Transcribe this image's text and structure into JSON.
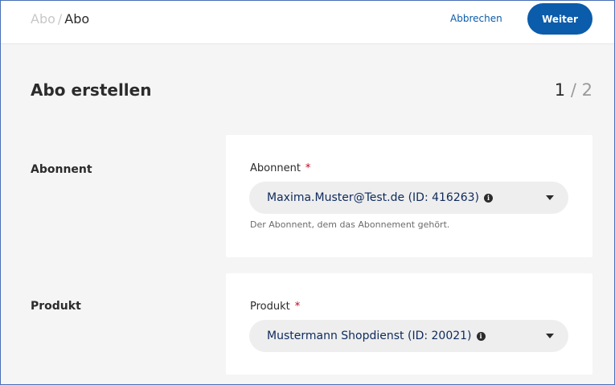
{
  "header": {
    "breadcrumb": {
      "parent": "Abo",
      "separator": "/",
      "current": "Abo"
    },
    "cancel_label": "Abbrechen",
    "next_label": "Weiter"
  },
  "page": {
    "title": "Abo erstellen",
    "step": {
      "current": "1",
      "separator": "/",
      "total": "2"
    }
  },
  "sections": {
    "subscriber": {
      "label": "Abonnent",
      "field_label": "Abonnent",
      "required_mark": "*",
      "value": "Maxima.Muster@Test.de (ID: 416263)",
      "info_glyph": "i",
      "help": "Der Abonnent, dem das Abonnement gehört."
    },
    "product": {
      "label": "Produkt",
      "field_label": "Produkt",
      "required_mark": "*",
      "value": "Mustermann Shopdienst (ID: 20021)",
      "info_glyph": "i"
    }
  },
  "colors": {
    "accent": "#0b5cab",
    "required": "#c0001a",
    "background": "#f5f5f5",
    "select_text": "#0d2a5c"
  },
  "icons": [
    "info-icon",
    "chevron-down-icon"
  ]
}
